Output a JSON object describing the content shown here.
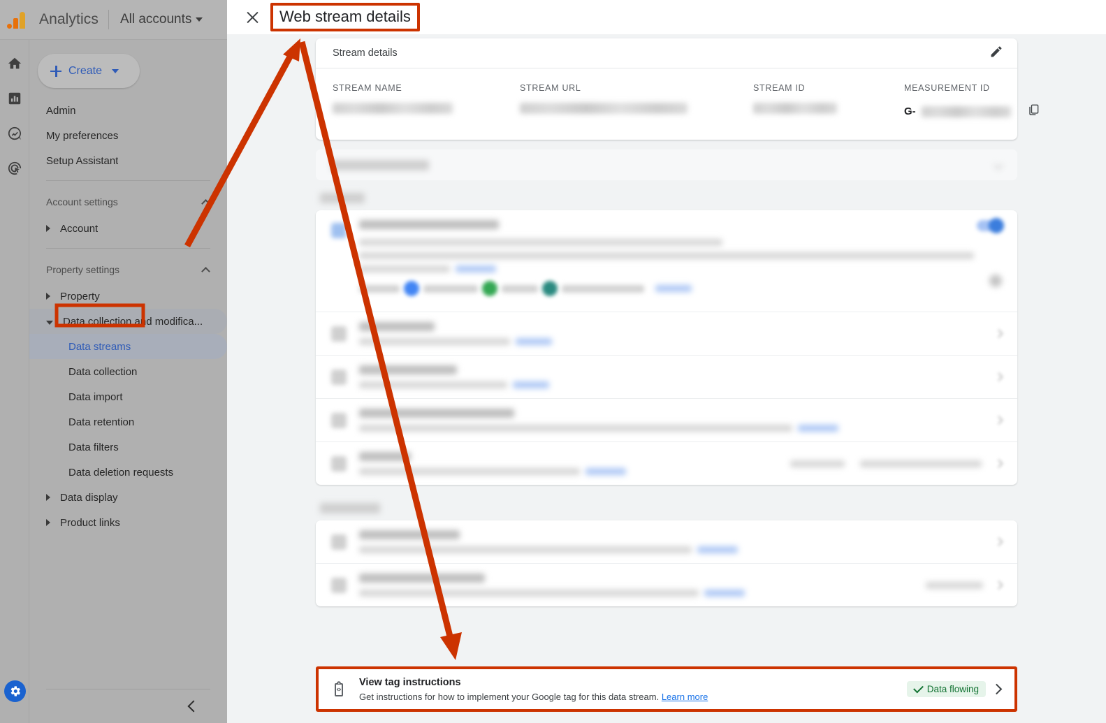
{
  "app": {
    "brand": "Analytics",
    "account_selector": "All accounts",
    "logo_colors": [
      "#e8710a",
      "#e0a228"
    ]
  },
  "rail": {
    "items": [
      {
        "name": "home-icon",
        "label": "Home"
      },
      {
        "name": "reports-icon",
        "label": "Reports"
      },
      {
        "name": "explore-icon",
        "label": "Explore"
      },
      {
        "name": "advertising-icon",
        "label": "Advertising"
      }
    ],
    "admin": {
      "name": "gear-icon",
      "label": "Admin",
      "color": "#1a62cf"
    }
  },
  "sidebar": {
    "create_button": "Create",
    "top_items": [
      {
        "label": "Admin"
      },
      {
        "label": "My preferences"
      },
      {
        "label": "Setup Assistant"
      }
    ],
    "account_settings_group": "Account settings",
    "account_items": [
      {
        "label": "Account"
      }
    ],
    "property_settings_group": "Property settings",
    "property_items": [
      {
        "label": "Property"
      },
      {
        "label": "Data collection and modifica..."
      }
    ],
    "data_collection_children": [
      {
        "label": "Data streams",
        "selected": true,
        "highlighted": true
      },
      {
        "label": "Data collection",
        "selected": false
      },
      {
        "label": "Data import",
        "selected": false
      },
      {
        "label": "Data retention",
        "selected": false
      },
      {
        "label": "Data filters",
        "selected": false
      },
      {
        "label": "Data deletion requests",
        "selected": false
      }
    ],
    "tail_items": [
      {
        "label": "Data display"
      },
      {
        "label": "Product links"
      }
    ]
  },
  "overlay": {
    "title": "Web stream details",
    "close_label": "Close"
  },
  "stream_details": {
    "card_title": "Stream details",
    "edit_label": "Edit",
    "columns": [
      {
        "label": "STREAM NAME",
        "value": ""
      },
      {
        "label": "STREAM URL",
        "value": ""
      },
      {
        "label": "STREAM ID",
        "value": ""
      },
      {
        "label": "MEASUREMENT ID",
        "value": "",
        "prefix": "G-",
        "copy_label": "Copy"
      }
    ]
  },
  "banner": {
    "icon": "code-clipboard-icon",
    "title": "View tag instructions",
    "subtitle": "Get instructions for how to implement your Google tag for this data stream.",
    "link": "Learn more",
    "status_badge": "Data flowing",
    "status_color": "#137333",
    "status_bg": "#e6f4ea"
  },
  "annotations": {
    "highlight_color": "#cc3300",
    "boxes": [
      "Web stream details",
      "Data streams",
      "View tag instructions banner"
    ],
    "arrows": 2
  }
}
